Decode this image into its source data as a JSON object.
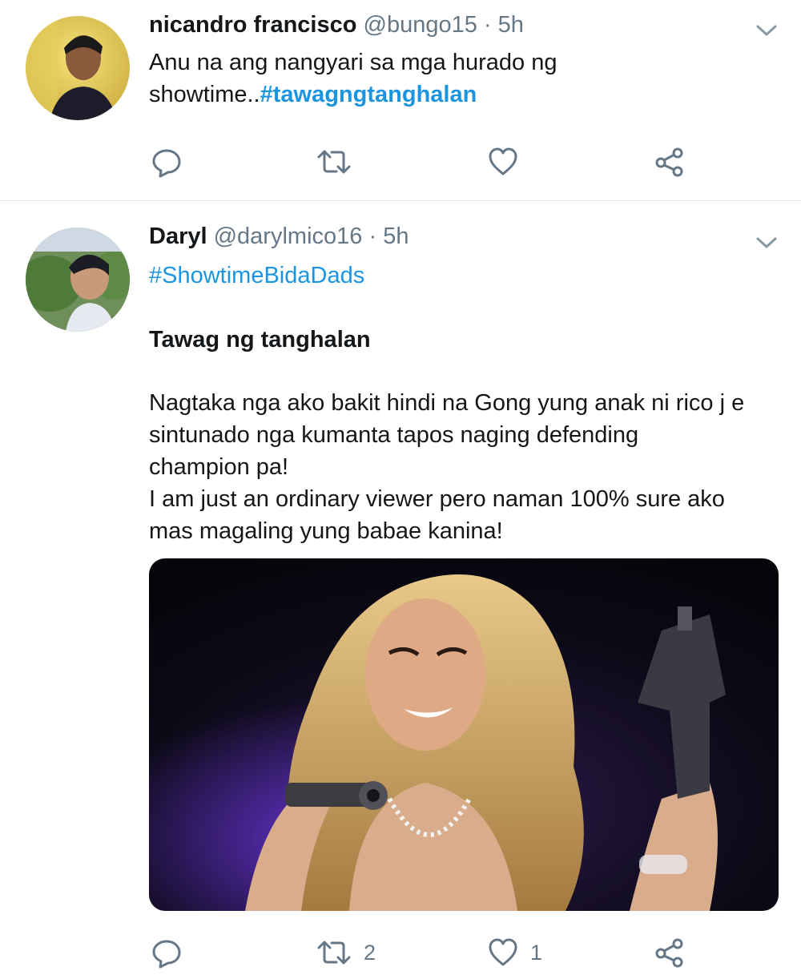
{
  "tweets": [
    {
      "name": "nicandro francisco",
      "handle": "@bungo15",
      "separator": "·",
      "time": "5h",
      "text_line1": "Anu na ang nangyari sa mga hurado ng",
      "text_line2_prefix": "showtime..",
      "text_line2_hashtag": "#tawagngtanghalan",
      "replies": "",
      "retweets": "",
      "likes": ""
    },
    {
      "name": "Daryl",
      "handle": "@darylmico16",
      "separator": "·",
      "time": "5h",
      "hashtag": "#ShowtimeBidaDads",
      "heading": "Tawag ng tanghalan",
      "body_line1": "Nagtaka nga ako bakit hindi na Gong yung anak ni rico j e",
      "body_line2": "sintunado nga kumanta tapos naging  defending",
      "body_line3": "champion pa!",
      "body_line4": "I am just an ordinary viewer pero naman 100% sure ako",
      "body_line5": "mas magaling yung babae kanina!",
      "replies": "",
      "retweets": "2",
      "likes": "1"
    }
  ],
  "icons": {
    "reply": "reply-icon",
    "retweet": "retweet-icon",
    "like": "heart-icon",
    "share": "share-icon",
    "caret": "chevron-down-icon"
  },
  "colors": {
    "hashtag": "#1b95e0",
    "secondary_text": "#657786",
    "primary_text": "#14171a",
    "divider": "#e1e8ed"
  }
}
